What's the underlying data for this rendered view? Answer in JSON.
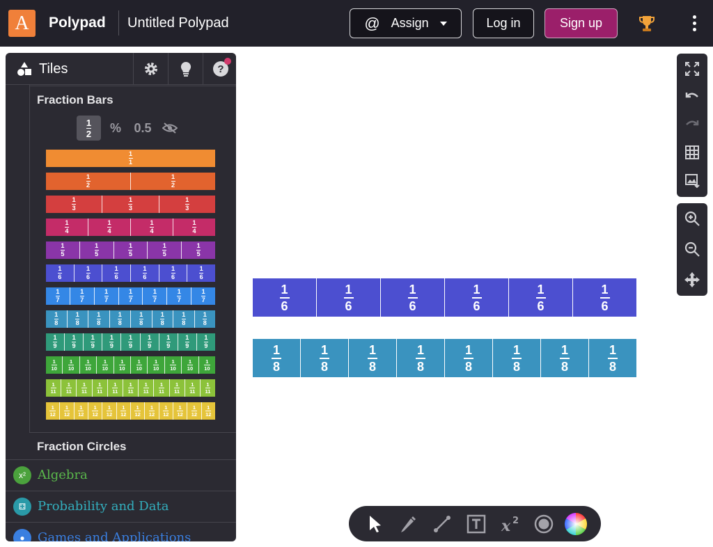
{
  "header": {
    "logo_letter": "A",
    "brand": "Polypad",
    "doc_title": "Untitled Polypad",
    "assign_label": "Assign",
    "assign_icon": "@",
    "login_label": "Log in",
    "signup_label": "Sign up"
  },
  "sidebar": {
    "title": "Tiles",
    "sections": {
      "fraction_bars": "Fraction Bars",
      "fraction_circles": "Fraction Circles"
    },
    "formats": {
      "fraction_num": "1",
      "fraction_den": "2",
      "percent": "%",
      "decimal": "0.5"
    },
    "bars": [
      {
        "denominator": "1",
        "count": 1,
        "color": "#f08c32"
      },
      {
        "denominator": "2",
        "count": 2,
        "color": "#e2632e"
      },
      {
        "denominator": "3",
        "count": 3,
        "color": "#d43f3f"
      },
      {
        "denominator": "4",
        "count": 4,
        "color": "#c42c68"
      },
      {
        "denominator": "5",
        "count": 5,
        "color": "#8a35a8"
      },
      {
        "denominator": "6",
        "count": 6,
        "color": "#4c4fd0"
      },
      {
        "denominator": "7",
        "count": 7,
        "color": "#3487e6"
      },
      {
        "denominator": "8",
        "count": 8,
        "color": "#3a93bf"
      },
      {
        "denominator": "9",
        "count": 9,
        "color": "#2f9a7a"
      },
      {
        "denominator": "10",
        "count": 10,
        "color": "#3ea63a"
      },
      {
        "denominator": "11",
        "count": 11,
        "color": "#8cc23a"
      },
      {
        "denominator": "12",
        "count": 12,
        "color": "#e5c43a"
      }
    ],
    "categories": [
      {
        "label": "Algebra",
        "icon": "x²",
        "color": "#5ab84b",
        "icon_bg": "#4ba23d"
      },
      {
        "label": "Probability and Data",
        "icon": "⚃",
        "color": "#33aebd",
        "icon_bg": "#2a9aa8"
      },
      {
        "label": "Games and Applications",
        "icon": "●",
        "color": "#3a7fe0",
        "icon_bg": "#3a7fe0"
      }
    ]
  },
  "canvas": {
    "bars": [
      {
        "numerator": "1",
        "denominator": "6",
        "count": 6,
        "color": "#4c4fd0"
      },
      {
        "numerator": "1",
        "denominator": "8",
        "count": 8,
        "color": "#3a93bf"
      }
    ]
  },
  "icons": {
    "trophy": "trophy-icon",
    "kebab": "more-vertical-icon"
  }
}
